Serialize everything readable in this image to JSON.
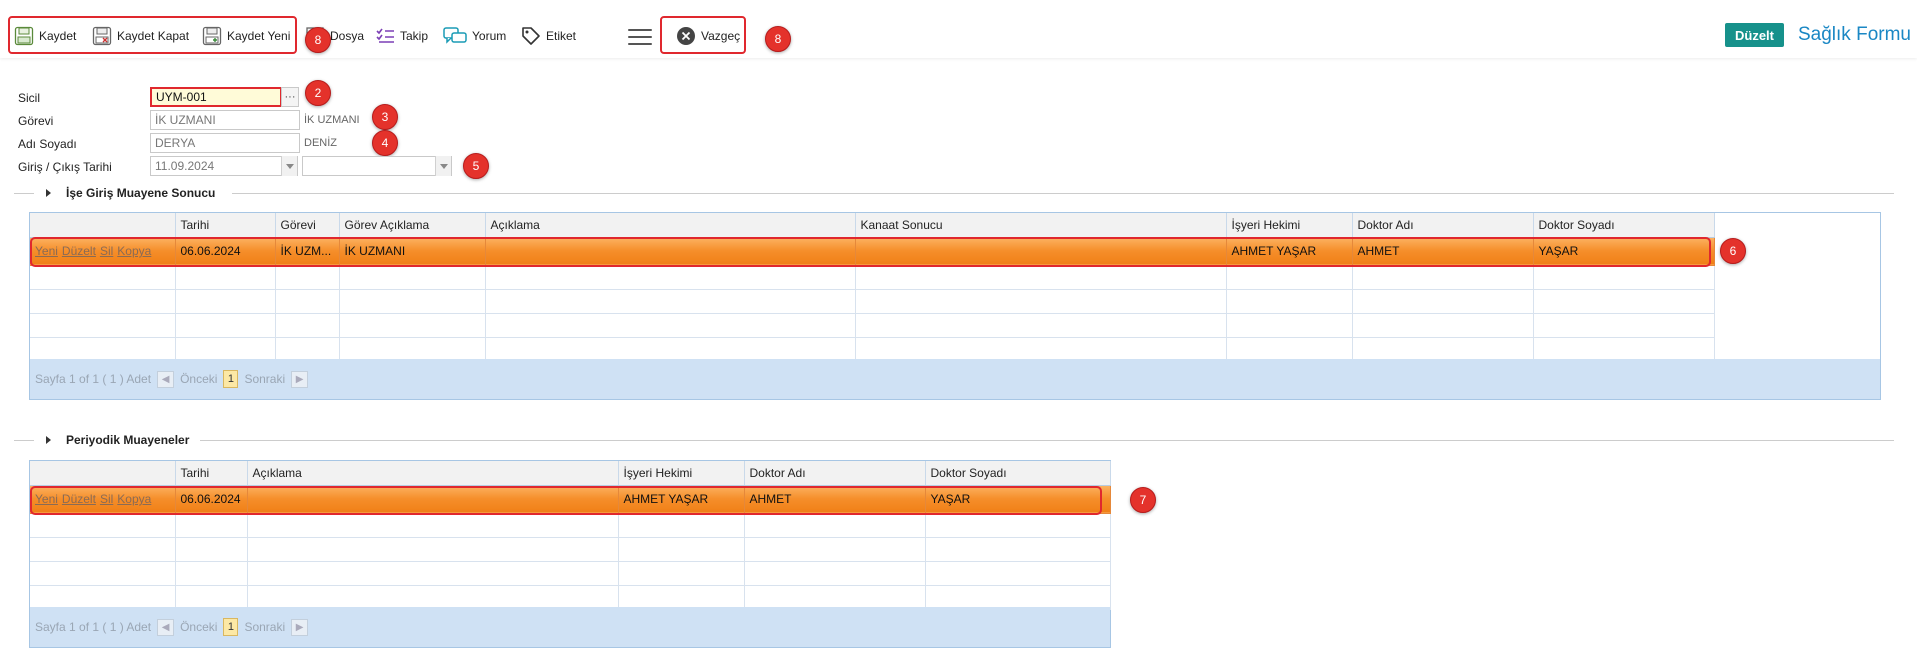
{
  "toolbar": {
    "kaydet": "Kaydet",
    "kaydet_kapat": "Kaydet Kapat",
    "kaydet_yeni": "Kaydet Yeni",
    "dosya": "Dosya",
    "takip": "Takip",
    "yorum": "Yorum",
    "etiket": "Etiket",
    "vazgec": "Vazgeç",
    "mode_badge": "Düzelt",
    "form_title": "Sağlık Formu"
  },
  "annotations": {
    "b_save_group": "8",
    "b_sicil": "2",
    "b_gorevi": "3",
    "b_adi": "4",
    "b_tarih": "5",
    "b_grid1": "6",
    "b_grid2": "7",
    "b_vazgec": "8"
  },
  "form": {
    "sicil_label": "Sicil",
    "sicil_value": "UYM-001",
    "ellipsis": "···",
    "gorevi_label": "Görevi",
    "gorevi_value": "İK UZMANI",
    "gorevi_desc": "İK UZMANI",
    "adi_label": "Adı Soyadı",
    "adi_value": "DERYA",
    "soyadi_value": "DENİZ",
    "tarih_label": "Giriş / Çıkış Tarihi",
    "giris_tarihi": "11.09.2024",
    "cikis_tarihi": ""
  },
  "section1": {
    "title": "İşe Giriş Muayene Sonucu",
    "columns": [
      "",
      "Tarihi",
      "Görevi",
      "Görev Açıklama",
      "Açıklama",
      "Kanaat Sonucu",
      "İşyeri Hekimi",
      "Doktor Adı",
      "Doktor Soyadı"
    ],
    "row_actions": [
      "Yeni",
      "Düzelt",
      "Sil",
      "Kopya"
    ],
    "rows": [
      [
        "06.06.2024",
        "İK UZM...",
        "İK UZMANI",
        "",
        "",
        "AHMET YAŞAR",
        "AHMET",
        "YAŞAR"
      ]
    ],
    "pager": {
      "text": "Sayfa 1 of 1 ( 1 ) Adet",
      "prev": "Önceki",
      "page": "1",
      "next": "Sonraki"
    }
  },
  "section2": {
    "title": "Periyodik Muayeneler",
    "columns": [
      "",
      "Tarihi",
      "Açıklama",
      "İşyeri Hekimi",
      "Doktor Adı",
      "Doktor Soyadı"
    ],
    "row_actions": [
      "Yeni",
      "Düzelt",
      "Sil",
      "Kopya"
    ],
    "rows": [
      [
        "06.06.2024",
        "",
        "AHMET YAŞAR",
        "AHMET",
        "YAŞAR"
      ]
    ],
    "pager": {
      "text": "Sayfa 1 of 1 ( 1 ) Adet",
      "prev": "Önceki",
      "page": "1",
      "next": "Sonraki"
    }
  },
  "colors": {
    "accent_red": "#e0282e",
    "badge_teal": "#16918b",
    "title_blue": "#1a87c4",
    "selected_row": "#f58e2a"
  }
}
